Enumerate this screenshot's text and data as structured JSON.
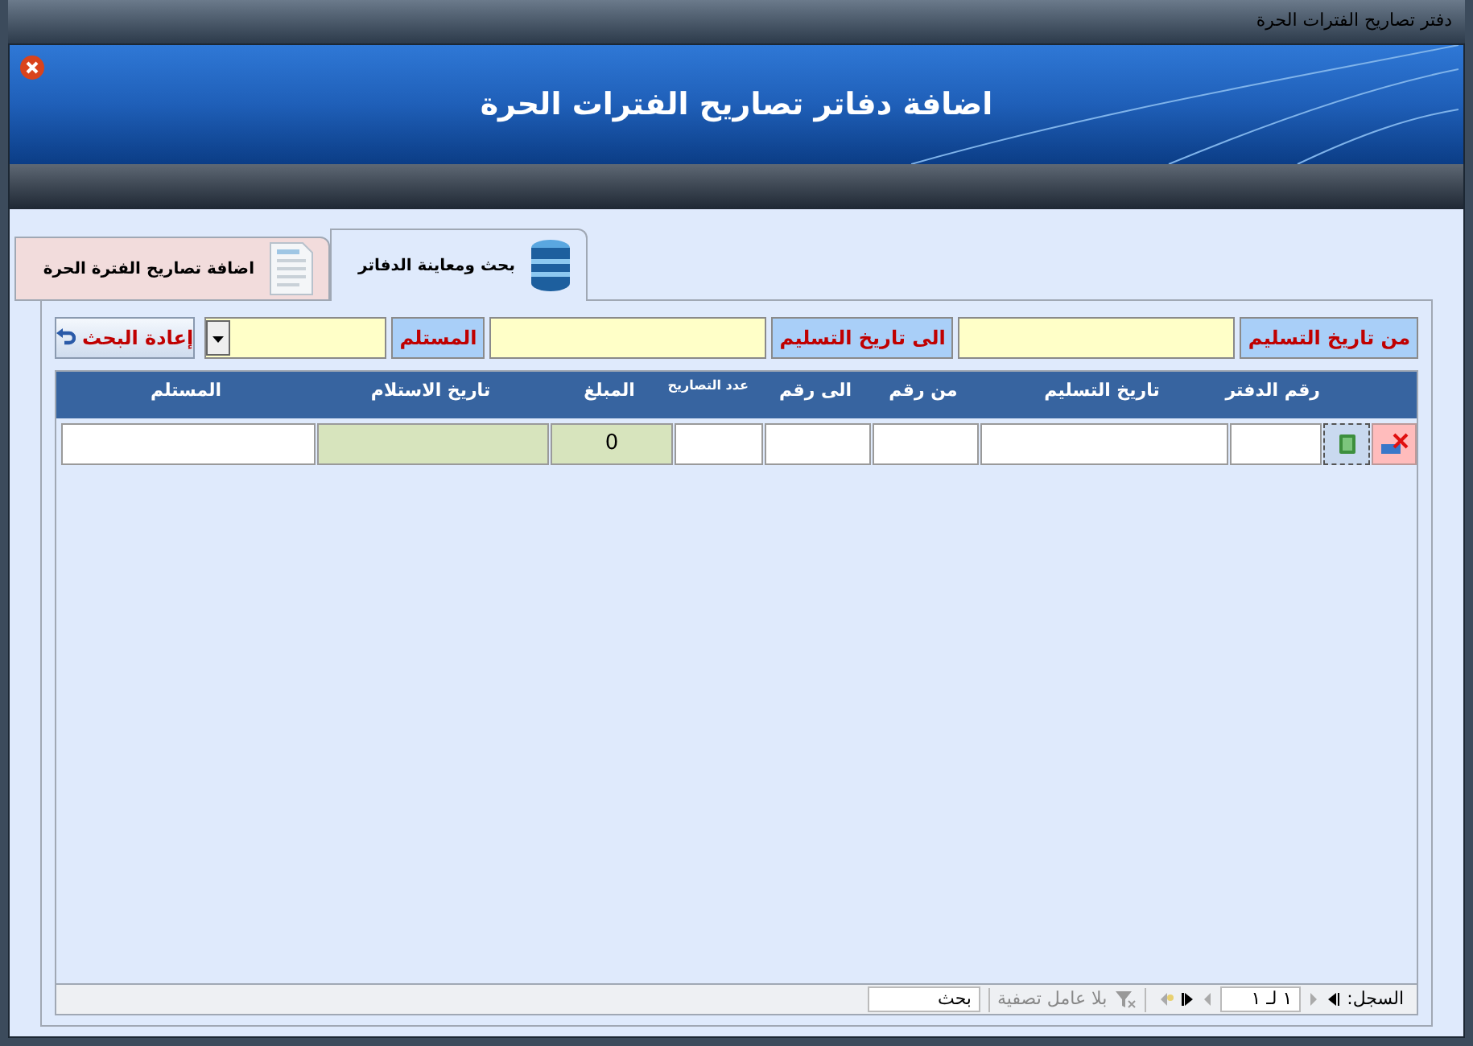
{
  "window": {
    "title": "دفتر تصاريح الفترات الحرة"
  },
  "header": {
    "title": "اضافة دفاتر تصاريح الفترات الحرة"
  },
  "tabs": [
    {
      "label": "بحث ومعاينة الدفاتر",
      "selected": true,
      "kind": "database"
    },
    {
      "label": "اضافة تصاريح الفترة الحرة",
      "selected": false,
      "kind": "document"
    }
  ],
  "filters": [
    {
      "label": "من تاريخ التسليم",
      "kind": "text"
    },
    {
      "label": "الى تاريخ التسليم",
      "kind": "text"
    },
    {
      "label": "المستلم",
      "kind": "dropdown"
    }
  ],
  "reset_button": {
    "label": "إعادة البحث"
  },
  "table": {
    "columns": [
      "رقم الدفتر",
      "تاريخ التسليم",
      "من رقم",
      "الى رقم",
      "عدد التصاريح",
      "المبلغ",
      "تاريخ الاستلام",
      "المستلم"
    ],
    "rows": [
      {
        "cells": [
          {
            "kind": "plain"
          },
          {
            "kind": "plain"
          },
          {
            "kind": "plain"
          },
          {
            "kind": "plain"
          },
          {
            "kind": "plain"
          },
          {
            "kind": "shaded",
            "value": "0"
          },
          {
            "kind": "shaded"
          },
          {
            "kind": "plain"
          }
        ]
      }
    ]
  },
  "navigator": {
    "label": "السجل:",
    "position": "١ لـ ١",
    "filter": "بلا عامل تصفية",
    "search": "بحث"
  }
}
